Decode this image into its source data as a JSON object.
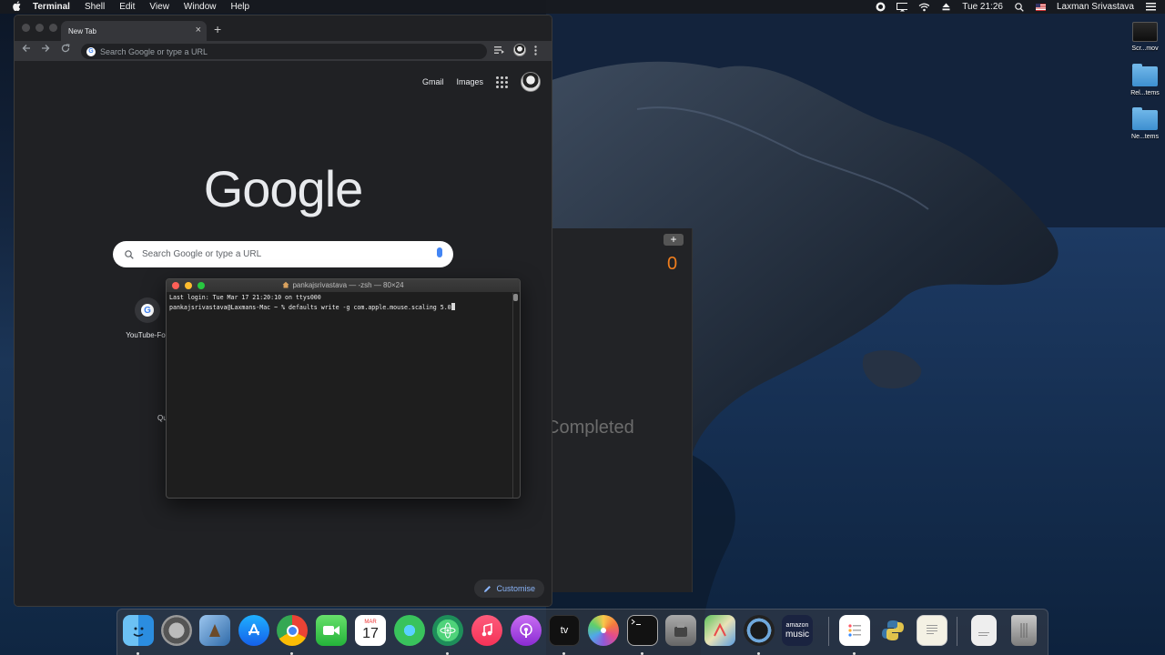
{
  "menubar": {
    "app_name": "Terminal",
    "items": [
      "Shell",
      "Edit",
      "View",
      "Window",
      "Help"
    ],
    "clock": "Tue 21:26",
    "user": "Laxman Srivastava",
    "icons": [
      "apple-icon",
      "record-icon",
      "display-icon",
      "wifi-icon",
      "eject-icon",
      "search-icon",
      "flag-icon",
      "list-icon"
    ]
  },
  "desktop": {
    "icons": [
      {
        "name": "Scr...mov",
        "kind": "movie"
      },
      {
        "name": "Rel...tems",
        "kind": "folder"
      },
      {
        "name": "Ne...tems",
        "kind": "folder"
      }
    ]
  },
  "background_app": {
    "add_label": "+",
    "count": "0",
    "status": "Completed",
    "count_color": "#f07e1d"
  },
  "chrome": {
    "tab_title": "New Tab",
    "tab_close": "×",
    "new_tab": "+",
    "omnibox_placeholder": "Search Google or type a URL",
    "links": {
      "gmail": "Gmail",
      "images": "Images"
    },
    "logo": "Google",
    "search_placeholder": "Search Google or type a URL",
    "shortcuts": [
      {
        "label": "YouTube-Fox"
      },
      {
        "label": "Qu"
      }
    ],
    "customise": "Customise"
  },
  "terminal": {
    "title": "pankajsrivastava — -zsh — 80×24",
    "lines": [
      "Last login: Tue Mar 17 21:20:10 on ttys000",
      "pankajsrivastava@Laxmans-Mac ~ % defaults write -g com.apple.mouse.scaling 5.0"
    ]
  },
  "dock": {
    "calendar_month": "MAR",
    "calendar_day": "17",
    "amazon_label_1": "amazon",
    "amazon_label_2": "music",
    "appletv_label": "tv",
    "items": [
      "finder",
      "system-preferences",
      "preview",
      "app-store",
      "chrome",
      "facetime",
      "calendar",
      "find-my",
      "atom",
      "music",
      "podcasts",
      "apple-tv",
      "photos",
      "terminal",
      "utility",
      "maps",
      "quicktime",
      "amazon-music",
      "reminders",
      "python-launcher",
      "textedit",
      "document",
      "trash"
    ]
  }
}
